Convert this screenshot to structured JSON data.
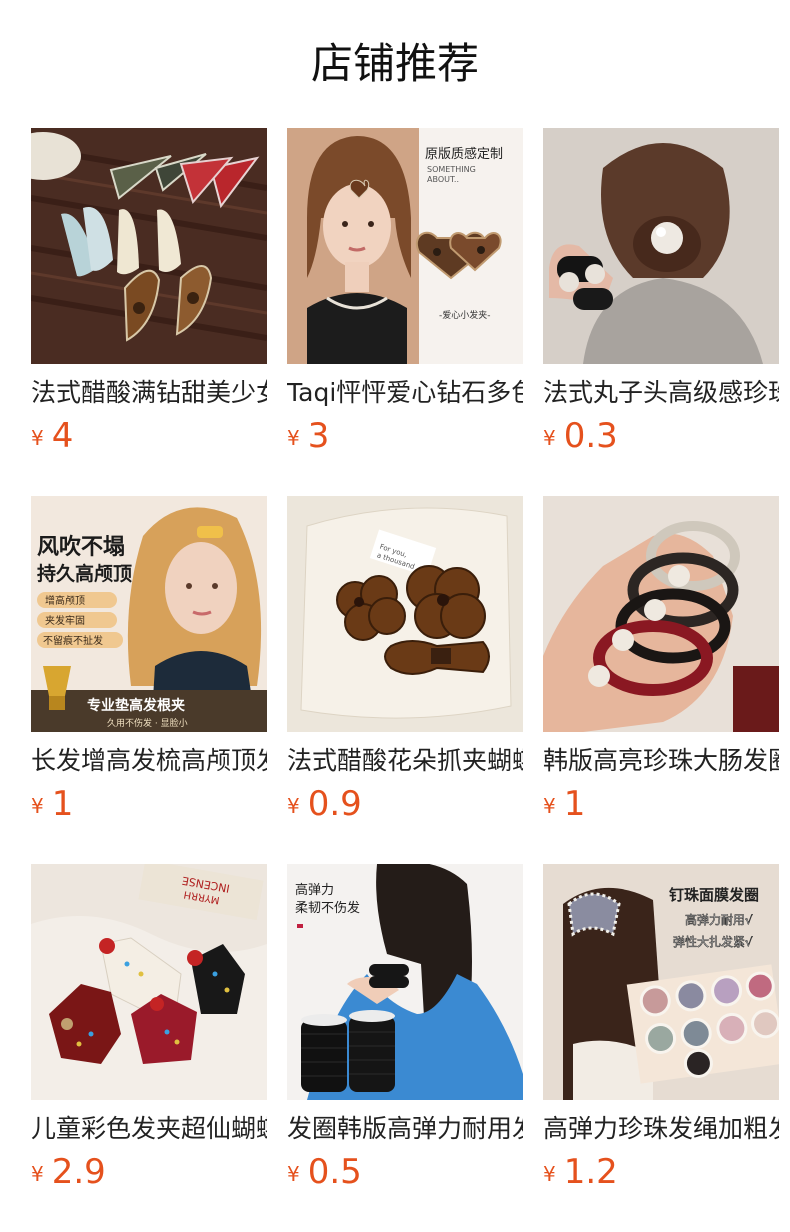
{
  "page": {
    "title": "店铺推荐"
  },
  "colors": {
    "price": "#e5511d",
    "title": "#111111",
    "text": "#222222",
    "background": "#ffffff"
  },
  "products": [
    {
      "name": "法式醋酸满钻甜美少女发夹",
      "currency": "¥",
      "price": "4",
      "image": "hair-clips-wood-table"
    },
    {
      "name": "Taqi怦怦爱心钻石多色发夹",
      "currency": "¥",
      "price": "3",
      "image": "heart-hair-clip-model",
      "image_text": {
        "headline": "原版质感定制",
        "sub1": "SOMETHING",
        "sub2": "ABOUT..",
        "caption": "-爱心小发夹-"
      }
    },
    {
      "name": "法式丸子头高级感珍珠发圈",
      "currency": "¥",
      "price": "0.3",
      "image": "pearl-scrunchie-bun"
    },
    {
      "name": "长发增高发梳高颅顶发夹",
      "currency": "¥",
      "price": "1",
      "image": "volume-clip-model",
      "image_text": {
        "headline1": "风吹不塌",
        "headline2": "持久高颅顶",
        "tag1": "增高颅顶",
        "tag2": "夹发牢固",
        "tag3": "不留痕不扯发",
        "banner": "专业垫高发根夹",
        "banner_sub": "久用不伤发 · 显脸小"
      }
    },
    {
      "name": "法式醋酸花朵抓夹蝴蝶结发夹",
      "currency": "¥",
      "price": "0.9",
      "image": "tortoise-flower-clips",
      "image_text": {
        "card1": "For you,",
        "card2": "a thousand"
      }
    },
    {
      "name": "韩版高亮珍珠大肠发圈",
      "currency": "¥",
      "price": "1",
      "image": "pearl-hair-ties-hand"
    },
    {
      "name": "儿童彩色发夹超仙蝴蝶结发饰",
      "currency": "¥",
      "price": "2.9",
      "image": "kids-cat-clips",
      "image_text": {
        "box1": "MYRRH",
        "box2": "INCENSE"
      }
    },
    {
      "name": "发圈韩版高弹力耐用发绳",
      "currency": "¥",
      "price": "0.5",
      "image": "black-hair-ties",
      "image_text": {
        "line1": "高弹力",
        "line2": "柔韧不伤发"
      }
    },
    {
      "name": "高弹力珍珠发绳加粗发圈",
      "currency": "¥",
      "price": "1.2",
      "image": "pearl-hair-rings-box",
      "image_text": {
        "headline": "钉珠面膜发圈",
        "line1": "高弹力耐用√",
        "line2": "弹性大扎发紧√"
      }
    }
  ]
}
